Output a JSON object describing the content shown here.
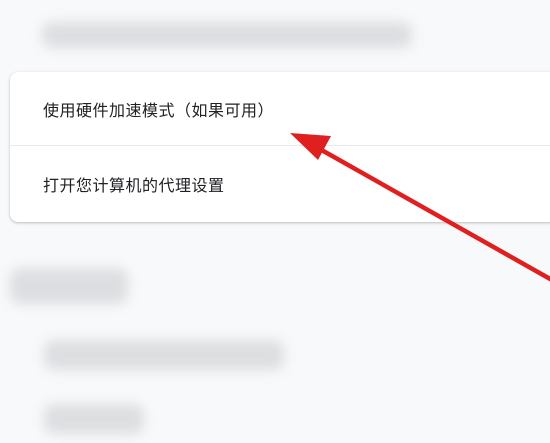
{
  "settings": {
    "hardware_acceleration_label": "使用硬件加速模式（如果可用）",
    "proxy_settings_label": "打开您计算机的代理设置"
  },
  "annotation": {
    "arrow_color": "#e02020"
  }
}
